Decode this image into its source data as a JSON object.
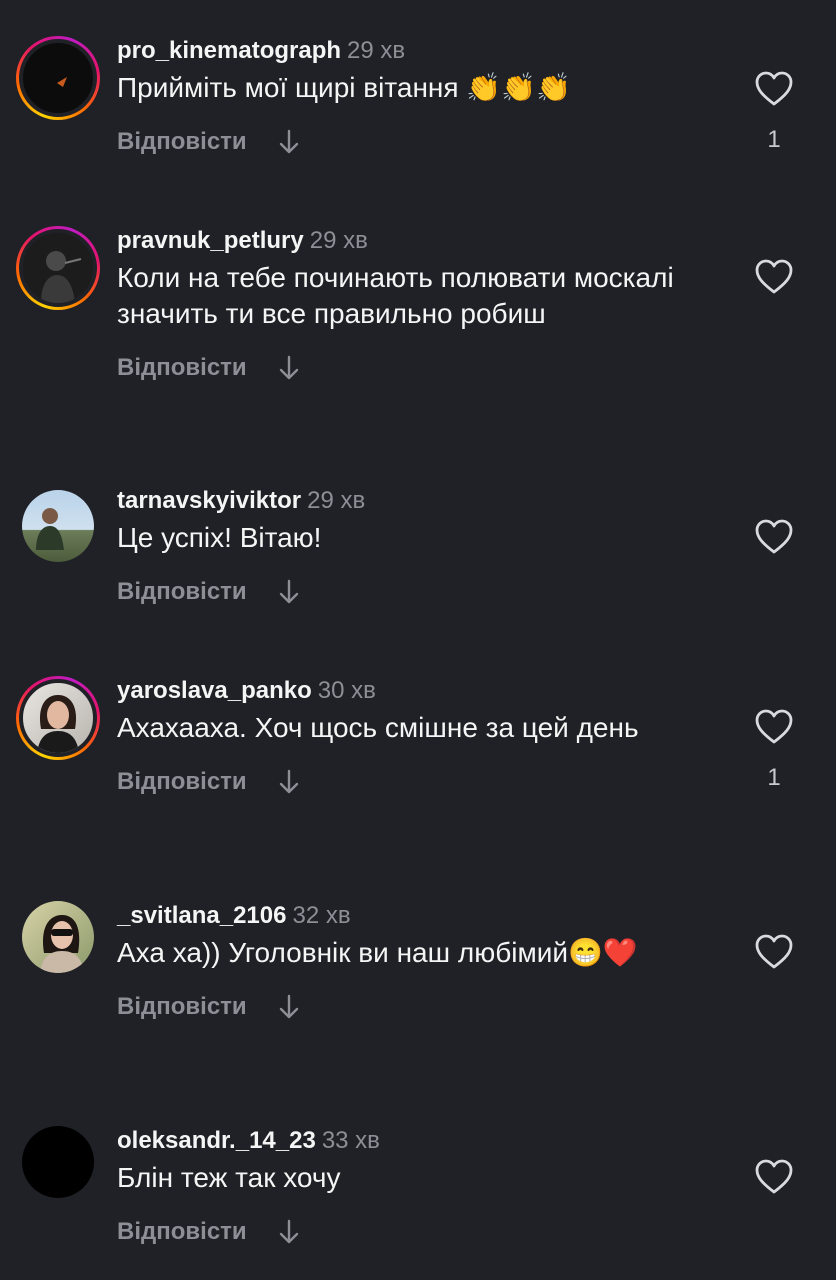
{
  "comments": [
    {
      "username": "pro_kinematograph",
      "time": "29 хв",
      "text": "Прийміть мої щирі вітання 👏👏👏",
      "reply": "Відповісти",
      "likes": "1",
      "story_ring": true
    },
    {
      "username": "pravnuk_petlury",
      "time": "29 хв",
      "text": "Коли на тебе починають полювати москалі значить ти все правильно робиш",
      "reply": "Відповісти",
      "likes": "",
      "story_ring": true
    },
    {
      "username": "tarnavskyiviktor",
      "time": "29 хв",
      "text": "Це успіх! Вітаю!",
      "reply": "Відповісти",
      "likes": "",
      "story_ring": false
    },
    {
      "username": "yaroslava_panko",
      "time": "30 хв",
      "text": "Ахахааха. Хоч щось смішне за цей день",
      "reply": "Відповісти",
      "likes": "1",
      "story_ring": true
    },
    {
      "username": "_svitlana_2106",
      "time": "32 хв",
      "text": "Аха ха)) Уголовнік ви наш любімий😁❤️",
      "reply": "Відповісти",
      "likes": "",
      "story_ring": false
    },
    {
      "username": "oleksandr._14_23",
      "time": "33 хв",
      "text": "Блін теж так хочу",
      "reply": "Відповісти",
      "likes": "",
      "story_ring": false
    }
  ],
  "colors": {
    "background": "#1f2126",
    "muted": "#8c8f96",
    "text": "#f5f5f5"
  },
  "icons": {
    "like": "heart-icon",
    "reply_arrow": "arrow-down-icon"
  }
}
